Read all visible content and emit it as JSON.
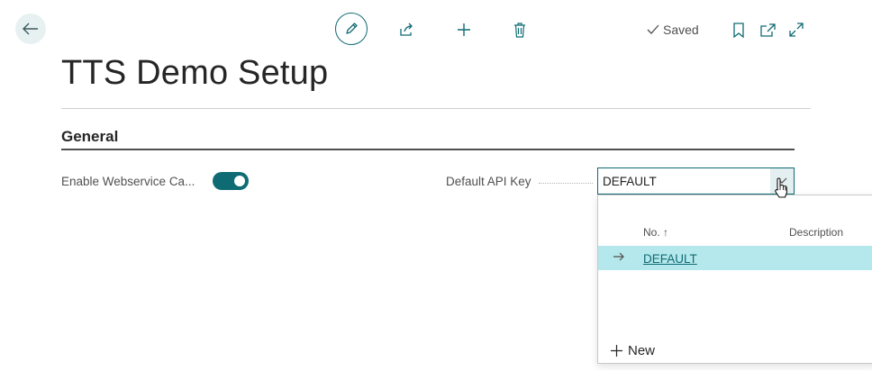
{
  "toolbar": {
    "saved_label": "Saved",
    "icons": [
      "back-arrow-icon",
      "pencil-icon",
      "share-icon",
      "plus-icon",
      "trash-icon",
      "checkmark-icon",
      "bookmark-icon",
      "open-new-window-icon",
      "expand-icon"
    ],
    "accent": "#0f6b73"
  },
  "page": {
    "title": "TTS Demo Setup"
  },
  "general": {
    "section_title": "General",
    "enable_webservice_label": "Enable Webservice Ca...",
    "enable_webservice_on": true,
    "default_api_key_label": "Default API Key",
    "default_api_key_value": "DEFAULT"
  },
  "lookup": {
    "columns": {
      "no": "No.",
      "no_sort": "↑",
      "description": "Description"
    },
    "rows": [
      {
        "no": "DEFAULT",
        "description": "",
        "selected": true
      }
    ],
    "new_label": "New",
    "selected_row_color": "#b5e8ec"
  }
}
